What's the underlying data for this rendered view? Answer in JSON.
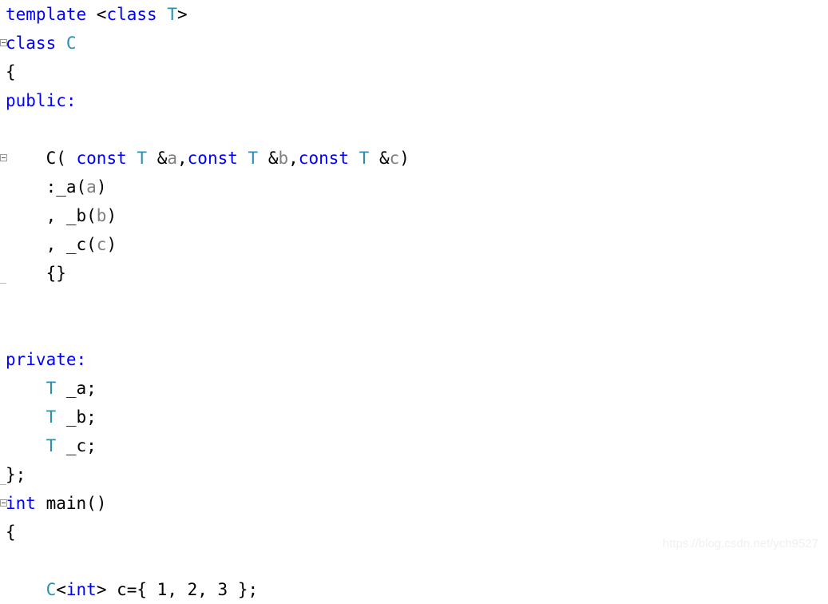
{
  "editor": {
    "language": "cpp",
    "background_color": "#ffffff",
    "colors": {
      "keyword": "#0000ff",
      "type": "#2b8fb0",
      "parameter": "#808080",
      "plain_text": "#000000",
      "fold_marker": "#9a9a9a",
      "watermark": "#f0f0f0"
    },
    "lines": [
      {
        "number": 1,
        "indent": 0,
        "fold_marker": "none",
        "tokens": [
          {
            "text": "template ",
            "kind": "keyword"
          },
          {
            "text": "<",
            "kind": "plain"
          },
          {
            "text": "class",
            "kind": "keyword"
          },
          {
            "text": " ",
            "kind": "plain"
          },
          {
            "text": "T",
            "kind": "type"
          },
          {
            "text": ">",
            "kind": "plain"
          }
        ]
      },
      {
        "number": 2,
        "indent": 0,
        "fold_marker": "box",
        "tokens": [
          {
            "text": "class",
            "kind": "keyword"
          },
          {
            "text": " ",
            "kind": "plain"
          },
          {
            "text": "C",
            "kind": "type"
          }
        ]
      },
      {
        "number": 3,
        "indent": 0,
        "fold_marker": "none",
        "tokens": [
          {
            "text": "{",
            "kind": "plain"
          }
        ]
      },
      {
        "number": 4,
        "indent": 0,
        "fold_marker": "none",
        "tokens": [
          {
            "text": "public:",
            "kind": "keyword"
          }
        ]
      },
      {
        "number": 5,
        "indent": 0,
        "fold_marker": "none",
        "tokens": []
      },
      {
        "number": 6,
        "indent": 4,
        "fold_marker": "box",
        "tokens": [
          {
            "text": "C( ",
            "kind": "plain"
          },
          {
            "text": "const",
            "kind": "keyword"
          },
          {
            "text": " ",
            "kind": "plain"
          },
          {
            "text": "T",
            "kind": "type"
          },
          {
            "text": " &",
            "kind": "plain"
          },
          {
            "text": "a",
            "kind": "parameter"
          },
          {
            "text": ",",
            "kind": "plain"
          },
          {
            "text": "const",
            "kind": "keyword"
          },
          {
            "text": " ",
            "kind": "plain"
          },
          {
            "text": "T",
            "kind": "type"
          },
          {
            "text": " &",
            "kind": "plain"
          },
          {
            "text": "b",
            "kind": "parameter"
          },
          {
            "text": ",",
            "kind": "plain"
          },
          {
            "text": "const",
            "kind": "keyword"
          },
          {
            "text": " ",
            "kind": "plain"
          },
          {
            "text": "T",
            "kind": "type"
          },
          {
            "text": " &",
            "kind": "plain"
          },
          {
            "text": "c",
            "kind": "parameter"
          },
          {
            "text": ")",
            "kind": "plain"
          }
        ]
      },
      {
        "number": 7,
        "indent": 4,
        "fold_marker": "none",
        "tokens": [
          {
            "text": ":_a(",
            "kind": "plain"
          },
          {
            "text": "a",
            "kind": "parameter"
          },
          {
            "text": ")",
            "kind": "plain"
          }
        ]
      },
      {
        "number": 8,
        "indent": 4,
        "fold_marker": "none",
        "tokens": [
          {
            "text": ", _b(",
            "kind": "plain"
          },
          {
            "text": "b",
            "kind": "parameter"
          },
          {
            "text": ")",
            "kind": "plain"
          }
        ]
      },
      {
        "number": 9,
        "indent": 4,
        "fold_marker": "none",
        "tokens": [
          {
            "text": ", _c(",
            "kind": "plain"
          },
          {
            "text": "c",
            "kind": "parameter"
          },
          {
            "text": ")",
            "kind": "plain"
          }
        ]
      },
      {
        "number": 10,
        "indent": 4,
        "fold_marker": "end",
        "tokens": [
          {
            "text": "{}",
            "kind": "plain"
          }
        ]
      },
      {
        "number": 11,
        "indent": 0,
        "fold_marker": "none",
        "tokens": []
      },
      {
        "number": 12,
        "indent": 0,
        "fold_marker": "none",
        "tokens": []
      },
      {
        "number": 13,
        "indent": 0,
        "fold_marker": "none",
        "tokens": [
          {
            "text": "private:",
            "kind": "keyword"
          }
        ]
      },
      {
        "number": 14,
        "indent": 4,
        "fold_marker": "none",
        "tokens": [
          {
            "text": "T",
            "kind": "type"
          },
          {
            "text": " _a;",
            "kind": "plain"
          }
        ]
      },
      {
        "number": 15,
        "indent": 4,
        "fold_marker": "none",
        "tokens": [
          {
            "text": "T",
            "kind": "type"
          },
          {
            "text": " _b;",
            "kind": "plain"
          }
        ]
      },
      {
        "number": 16,
        "indent": 4,
        "fold_marker": "none",
        "tokens": [
          {
            "text": "T",
            "kind": "type"
          },
          {
            "text": " _c;",
            "kind": "plain"
          }
        ]
      },
      {
        "number": 17,
        "indent": 0,
        "fold_marker": "end",
        "tokens": [
          {
            "text": "};",
            "kind": "plain"
          }
        ]
      },
      {
        "number": 18,
        "indent": 0,
        "fold_marker": "box",
        "tokens": [
          {
            "text": "int",
            "kind": "keyword"
          },
          {
            "text": " main()",
            "kind": "plain"
          }
        ]
      },
      {
        "number": 19,
        "indent": 0,
        "fold_marker": "none",
        "tokens": [
          {
            "text": "{",
            "kind": "plain"
          }
        ]
      },
      {
        "number": 20,
        "indent": 0,
        "fold_marker": "none",
        "tokens": []
      },
      {
        "number": 21,
        "indent": 4,
        "fold_marker": "none",
        "tokens": [
          {
            "text": "C",
            "kind": "type"
          },
          {
            "text": "<",
            "kind": "plain"
          },
          {
            "text": "int",
            "kind": "keyword"
          },
          {
            "text": "> c={ 1, 2, 3 };",
            "kind": "plain"
          }
        ]
      }
    ]
  },
  "watermark": {
    "text": "https://blog.csdn.net/ych9527"
  }
}
